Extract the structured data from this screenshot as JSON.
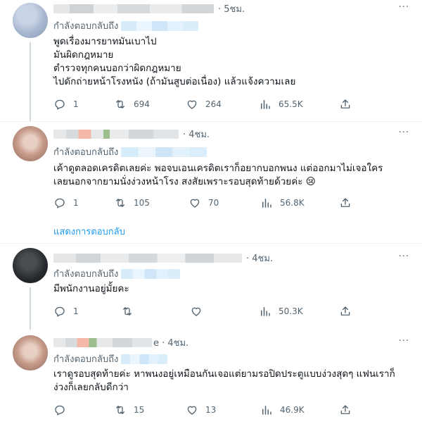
{
  "reply_prefix": "กำลังตอบกลับถึง",
  "more_label": "···",
  "show_replies_label": "แสดงการตอบกลับ",
  "tweets": [
    {
      "time": "· 5ชม.",
      "lines": [
        "พูดเรื่องมารยาทมันเบาไป",
        "มันผิดกฎหมาย",
        "ตำรวจทุกคนบอกว่าผิดกฎหมาย",
        "ไปดักถ่ายหน้าโรงหนัง (ถ้ามันสูบต่อเนื่อง) แล้วแจ้งความเลย"
      ],
      "replies": "1",
      "retweets": "694",
      "likes": "264",
      "views": "65.5K"
    },
    {
      "time": "· 4ชม.",
      "lines": [
        "เค้าดูตลอดเครดิตเลยค่ะ พอจบเอนเครดิตเราก็อยากบอกพนง แต่ออกมาไม่เจอใคร",
        "เลยนอกจากยามนั่งง่วงหน้าโรง สงสัยเพราะรอบสุดท้ายด้วยค่ะ 😢"
      ],
      "replies": "1",
      "retweets": "105",
      "likes": "70",
      "views": "56.8K"
    },
    {
      "time": "· 4ชม.",
      "lines": [
        "มีพนักงานอยู่มั้ยคะ"
      ],
      "replies": "1",
      "retweets": "",
      "likes": "",
      "views": "50.3K"
    },
    {
      "time": "e · 4ชม.",
      "lines": [
        "เรา​ดูรอบสุดท้ายค่ะ หาพนงอยู่เหมือนกันเจอแต่ยามรอปิดประตูแบบง่วงสุดๆ แฟนเราก็",
        "ง่วงก็เลยกลับดีกว่า"
      ],
      "replies": "",
      "retweets": "15",
      "likes": "13",
      "views": "46.9K"
    }
  ],
  "colors": {
    "accent": "#1d9bf0",
    "secondary": "#536471",
    "text": "#0f1419",
    "divider": "#eff3f4"
  }
}
